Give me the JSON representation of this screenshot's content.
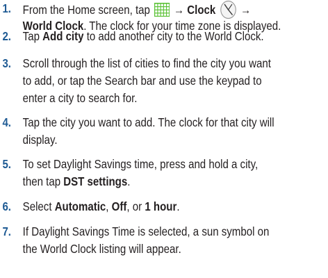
{
  "colors": {
    "number": "#1f5b94",
    "text": "#231f20",
    "apps_icon": "#5bc236"
  },
  "icons": {
    "apps": "apps-grid-icon",
    "clock": "clock-icon"
  },
  "steps": [
    {
      "num": "1.",
      "lines": [
        {
          "parts": [
            {
              "t": "From the Home screen, tap ",
              "b": false
            },
            {
              "icon": "apps"
            },
            {
              "t": " → Clock ",
              "b": true
            },
            {
              "icon": "clock"
            },
            {
              "t": " →",
              "b": true
            }
          ]
        },
        {
          "parts": [
            {
              "t": "World Clock",
              "b": true
            },
            {
              "t": ". The clock for your time zone is displayed.",
              "b": false
            }
          ]
        }
      ]
    },
    {
      "num": "2.",
      "lines": [
        {
          "parts": [
            {
              "t": "Tap ",
              "b": false
            },
            {
              "t": "Add city",
              "b": true
            },
            {
              "t": " to add another city to the World Clock.",
              "b": false
            }
          ]
        }
      ]
    },
    {
      "num": "3.",
      "lines": [
        {
          "parts": [
            {
              "t": "Scroll through the list of cities to find the city you want",
              "b": false
            }
          ]
        },
        {
          "parts": [
            {
              "t": "to add, or tap the Search bar and use the keypad to",
              "b": false
            }
          ]
        },
        {
          "parts": [
            {
              "t": "enter a city to search for.",
              "b": false
            }
          ]
        }
      ]
    },
    {
      "num": "4.",
      "lines": [
        {
          "parts": [
            {
              "t": "Tap the city you want to add. The clock for that city will",
              "b": false
            }
          ]
        },
        {
          "parts": [
            {
              "t": "display.",
              "b": false
            }
          ]
        }
      ]
    },
    {
      "num": "5.",
      "lines": [
        {
          "parts": [
            {
              "t": "To set Daylight Savings time, press and hold a city,",
              "b": false
            }
          ]
        },
        {
          "parts": [
            {
              "t": "then tap ",
              "b": false
            },
            {
              "t": "DST settings",
              "b": true
            },
            {
              "t": ".",
              "b": false
            }
          ]
        }
      ]
    },
    {
      "num": "6.",
      "lines": [
        {
          "parts": [
            {
              "t": "Select ",
              "b": false
            },
            {
              "t": "Automatic",
              "b": true
            },
            {
              "t": ", ",
              "b": false
            },
            {
              "t": "Off",
              "b": true
            },
            {
              "t": ", or ",
              "b": false
            },
            {
              "t": "1 hour",
              "b": true
            },
            {
              "t": ".",
              "b": false
            }
          ]
        }
      ]
    },
    {
      "num": "7.",
      "lines": [
        {
          "parts": [
            {
              "t": "If Daylight Savings Time is selected, a sun symbol on",
              "b": false
            }
          ]
        },
        {
          "parts": [
            {
              "t": "the World Clock listing will appear.",
              "b": false
            }
          ]
        }
      ]
    }
  ]
}
